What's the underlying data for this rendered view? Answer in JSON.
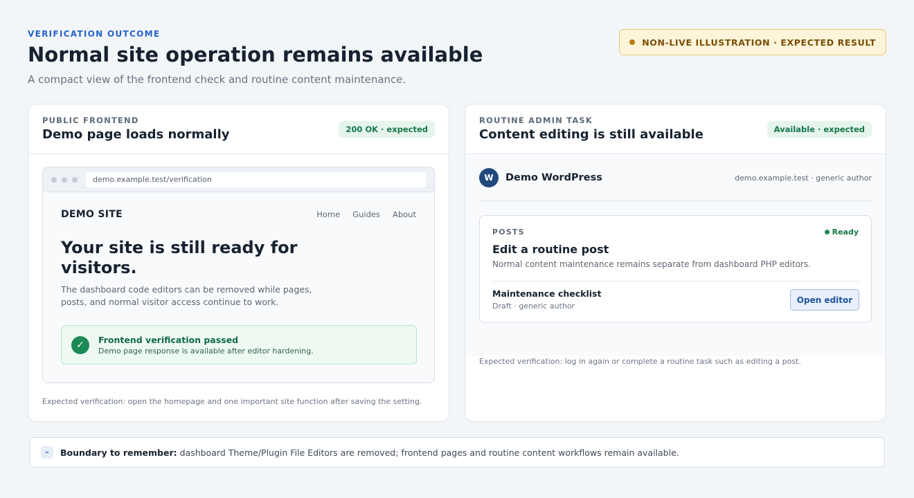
{
  "header": {
    "eyebrow": "VERIFICATION OUTCOME",
    "title": "Normal site operation remains available",
    "subtitle": "A compact view of the frontend check and routine content maintenance.",
    "notice": "NON-LIVE ILLUSTRATION · EXPECTED RESULT"
  },
  "frontend_card": {
    "eyebrow": "PUBLIC FRONTEND",
    "title": "Demo page loads normally",
    "badge": "200 OK · expected",
    "browser": {
      "url": "demo.example.test/verification",
      "site_logo": "DEMO SITE",
      "nav": [
        "Home",
        "Guides",
        "About"
      ],
      "hero": "Your site is still ready for visitors.",
      "body": "The dashboard code editors can be removed while pages, posts, and normal visitor access continue to work.",
      "verify_title": "Frontend verification passed",
      "verify_sub": "Demo page response is available after editor hardening."
    },
    "footnote": "Expected verification: open the homepage and one important site function after saving the setting."
  },
  "admin_card": {
    "eyebrow": "ROUTINE ADMIN TASK",
    "title": "Content editing is still available",
    "badge": "Available · expected",
    "wp_logo": "W",
    "wp_name": "Demo WordPress",
    "wp_meta": "demo.example.test · generic author",
    "posts": {
      "eyebrow": "POSTS",
      "status": "Ready",
      "title": "Edit a routine post",
      "desc": "Normal content maintenance remains separate from dashboard PHP editors.",
      "item_title": "Maintenance checklist",
      "item_meta": "Draft · generic author",
      "button": "Open editor"
    },
    "footnote": "Expected verification: log in again or complete a routine task such as editing a post."
  },
  "boundary": {
    "label": "Boundary to remember:",
    "text": "dashboard Theme/Plugin File Editors are removed; frontend pages and routine content workflows remain available."
  },
  "colors": {
    "accent": "#2563c9",
    "success": "#1b8a55",
    "warning_bg": "#fdf4d9",
    "wp_brand": "#21497e"
  }
}
